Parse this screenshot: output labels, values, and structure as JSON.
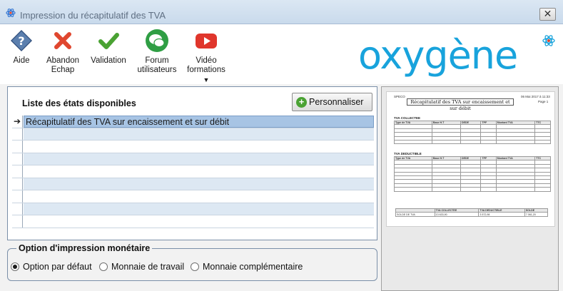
{
  "window": {
    "title": "Impression du récapitulatif des TVA",
    "close_glyph": "✕"
  },
  "toolbar": {
    "buttons": [
      {
        "label": "Aide",
        "icon": "help-icon"
      },
      {
        "label": "Abandon\nEchap",
        "label_line1": "Abandon",
        "label_line2": "Echap",
        "icon": "cancel-icon"
      },
      {
        "label": "Validation",
        "icon": "check-icon"
      },
      {
        "label_line1": "Forum",
        "label_line2": "utilisateurs",
        "icon": "forum-icon"
      },
      {
        "label_line1": "Vidéo",
        "label_line2": "formations",
        "icon": "video-icon",
        "caret": "▼"
      }
    ]
  },
  "logo": {
    "text": "oxygène"
  },
  "states": {
    "title": "Liste des états disponibles",
    "customize_label": "Personnaliser",
    "customize_glyph": "+",
    "selected_marker": "➔",
    "items": [
      "Récapitulatif des TVA sur encaissement et sur débit",
      "",
      "",
      "",
      "",
      "",
      "",
      "",
      ""
    ]
  },
  "currency_option": {
    "title": "Option d'impression monétaire",
    "options": [
      {
        "label": "Option par défaut",
        "selected": true
      },
      {
        "label": "Monnaie de travail",
        "selected": false
      },
      {
        "label": "Monnaie complémentaire",
        "selected": false
      }
    ]
  },
  "preview": {
    "company": "SPECO",
    "date": "06 Mai 2017 à 11:33",
    "page": "Page 1",
    "title": "Récapitulatif des TVA sur encaissement et sur débit",
    "section_collected": "TVA COLLECTEE",
    "section_deductible": "TVA DEDUCTIBLE",
    "columns": [
      "Type de TVA",
      "Base H.T",
      "DEDE",
      "TPF",
      "Montant TVA",
      "TTC"
    ],
    "summary_headers": [
      "",
      "TVA COLLECTEE",
      "TVA DEDUCTIBLE",
      "SOLDE"
    ],
    "summary_label": "SOLDE DE TVA",
    "summary_values": [
      "13 633,90",
      "3 572,98",
      "7 061,20"
    ]
  },
  "colors": {
    "titlebar": "#c9daec",
    "selection": "#a7c4e4",
    "alt_row": "#dde8f3",
    "logo": "#18a3dc"
  }
}
